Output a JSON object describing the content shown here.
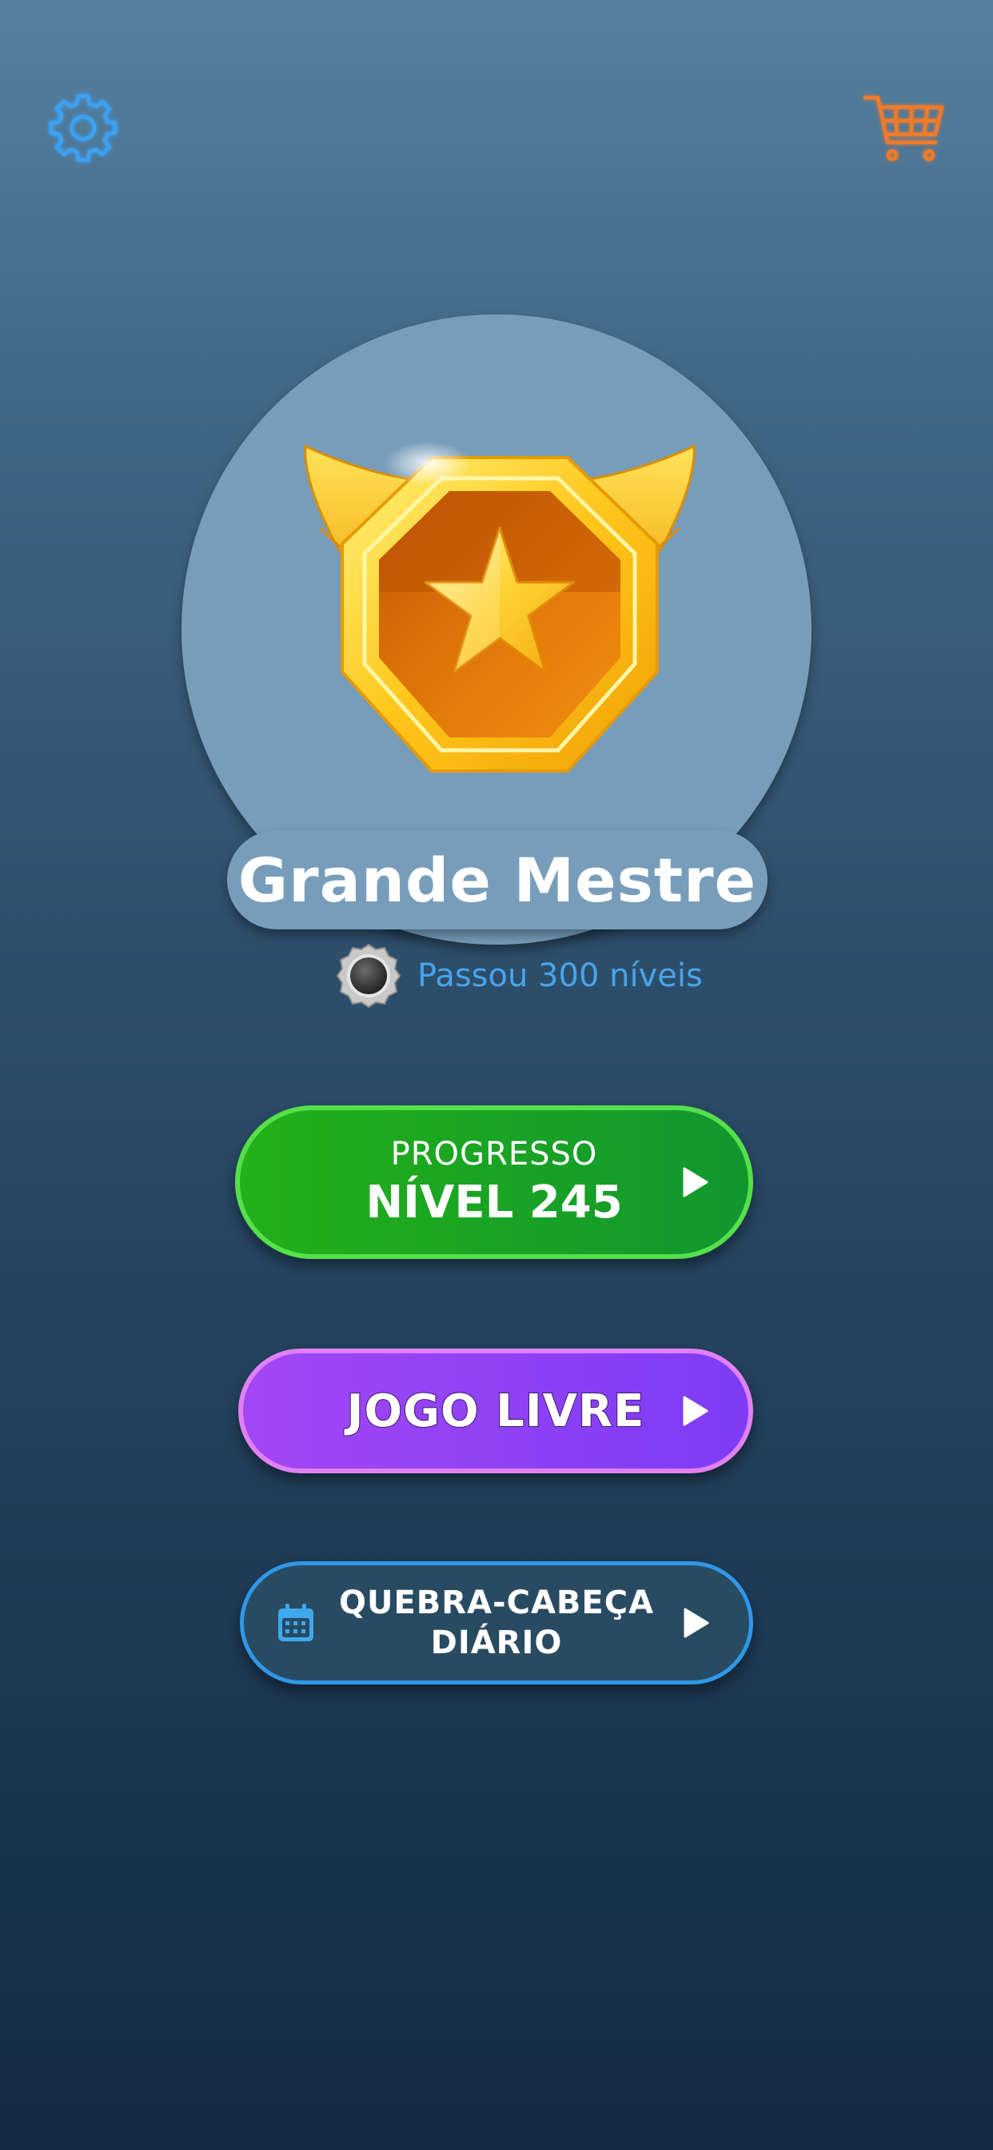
{
  "header": {
    "settings_icon": "gear-icon",
    "cart_icon": "shopping-cart-icon"
  },
  "rank": {
    "title": "Grande Mestre",
    "emblem_icon": "winged-star-badge-icon"
  },
  "achievement": {
    "icon": "medal-icon",
    "text": "Passou 300 níveis"
  },
  "buttons": {
    "progress": {
      "label": "PROGRESSO",
      "level": "NÍVEL 245"
    },
    "free_game": {
      "label": "JOGO LIVRE"
    },
    "daily_puzzle": {
      "line1": "QUEBRA-CABEÇA",
      "line2": "DIÁRIO",
      "icon": "calendar-icon"
    }
  },
  "colors": {
    "settings_accent": "#3ea0f0",
    "cart_accent": "#f07a2a",
    "progress_green": "#1ea52a",
    "free_game_purple": "#8c40f5",
    "daily_blue_border": "#2f97e8",
    "achievement_text": "#48a4ea"
  }
}
